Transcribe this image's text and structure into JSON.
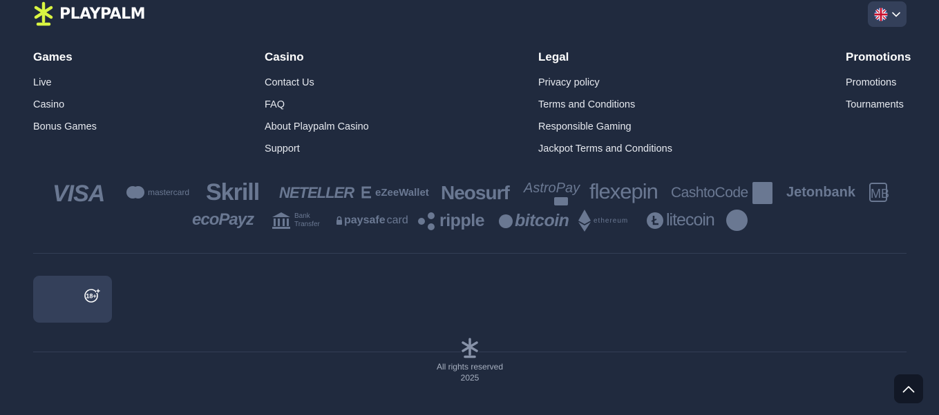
{
  "brand": {
    "name": "PLAYPALM",
    "accent_color": "#d9f542"
  },
  "language": {
    "flag_icon": "uk-flag-icon",
    "chevron_icon": "chevron-down-icon"
  },
  "columns": [
    {
      "title": "Games",
      "links": [
        "Live",
        "Casino",
        "Bonus Games"
      ]
    },
    {
      "title": "Casino",
      "links": [
        "Contact Us",
        "FAQ",
        "About Playpalm Casino",
        "Support"
      ]
    },
    {
      "title": "Legal",
      "links": [
        "Privacy policy",
        "Terms and Conditions",
        "Responsible Gaming",
        "Jackpot Terms and Conditions"
      ]
    },
    {
      "title": "Promotions",
      "links": [
        "Promotions",
        "Tournaments"
      ]
    }
  ],
  "payments": {
    "visa": "VISA",
    "mastercard": "mastercard",
    "skrill": "Skrill",
    "neteller": "NETELLER",
    "ezeewallet": "eZeeWallet",
    "neosurf": "Neosurf",
    "astropay": "AstroPay",
    "flexepin": "flexepin",
    "cashtocode": "CashtoCode",
    "jetonbank": "Jetonbank",
    "mb": "MB",
    "ecopayz": "ecoPayz",
    "bank_line1": "Bank",
    "bank_line2": "Transfer",
    "paysafe_bold": "paysafe",
    "paysafe_light": "card",
    "ripple": "ripple",
    "bitcoin": "bitcoin",
    "ethereum": "ethereum",
    "litecoin": "litecoin"
  },
  "age_badge": "18+",
  "footer": {
    "rights": "All rights reserved",
    "year": "2025"
  },
  "colors": {
    "background": "#202a3e",
    "card": "#34405a",
    "logo_muted": "#6a7892"
  }
}
